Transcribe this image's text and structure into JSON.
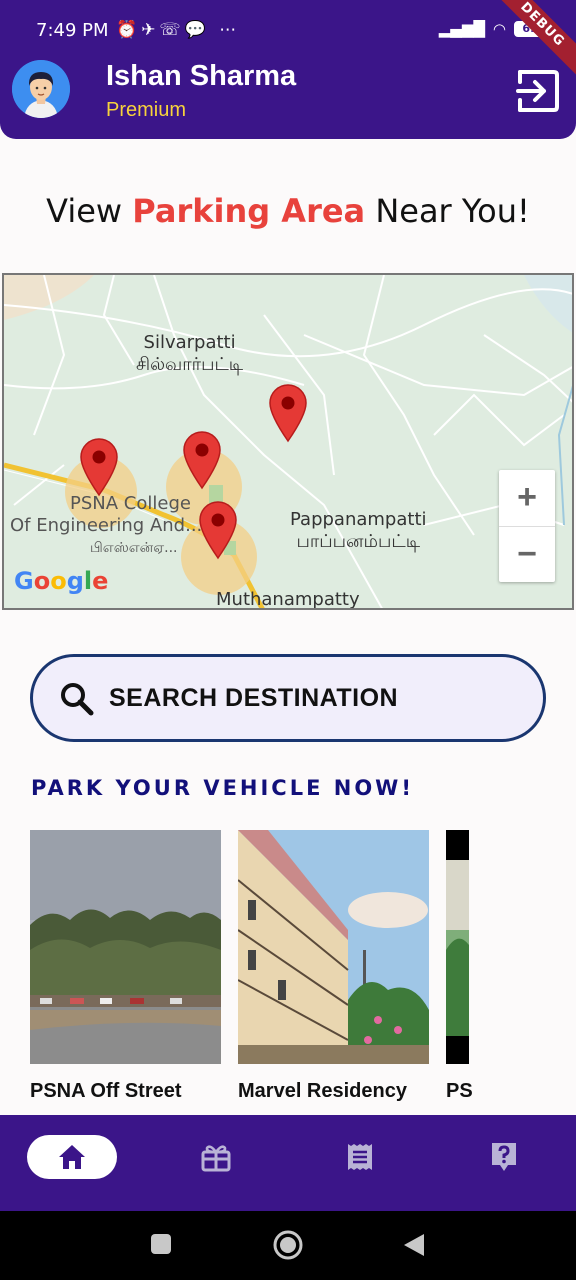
{
  "status_bar": {
    "time": "7:49 PM",
    "icons": [
      "alarm-icon",
      "telegram-icon",
      "whatsapp-icon",
      "chat-icon",
      "more-icon"
    ],
    "battery": "69",
    "debug_banner": "DEBUG"
  },
  "header": {
    "user_name": "Ishan Sharma",
    "tier": "Premium"
  },
  "headline": {
    "prefix": "View",
    "highlight": "Parking Area",
    "suffix": "Near You!"
  },
  "map": {
    "labels": {
      "silvarpatti": "Silvarpatti",
      "silvarpatti_ta": "சில்வார்பட்டி",
      "psna": "PSNA College",
      "psna2": "Of Engineering And...",
      "psna_ta": "பிஎஸ்என்ஏ...",
      "pappan": "Pappanampatti",
      "pappan_ta": "பாப்பனம்பட்டி",
      "muthan": "Muthanampatty"
    },
    "zoom_in": "+",
    "zoom_out": "−",
    "google_logo": "Google"
  },
  "search": {
    "label": "SEARCH DESTINATION"
  },
  "section": {
    "title": "PARK YOUR VEHICLE NOW!"
  },
  "cards": [
    {
      "title": "PSNA Off Street"
    },
    {
      "title": "Marvel Residency"
    },
    {
      "title": "PS"
    }
  ],
  "colors": {
    "primary": "#3b1589",
    "accent": "#e8423c",
    "tier": "#f7d23c",
    "section_title": "#12107a"
  }
}
